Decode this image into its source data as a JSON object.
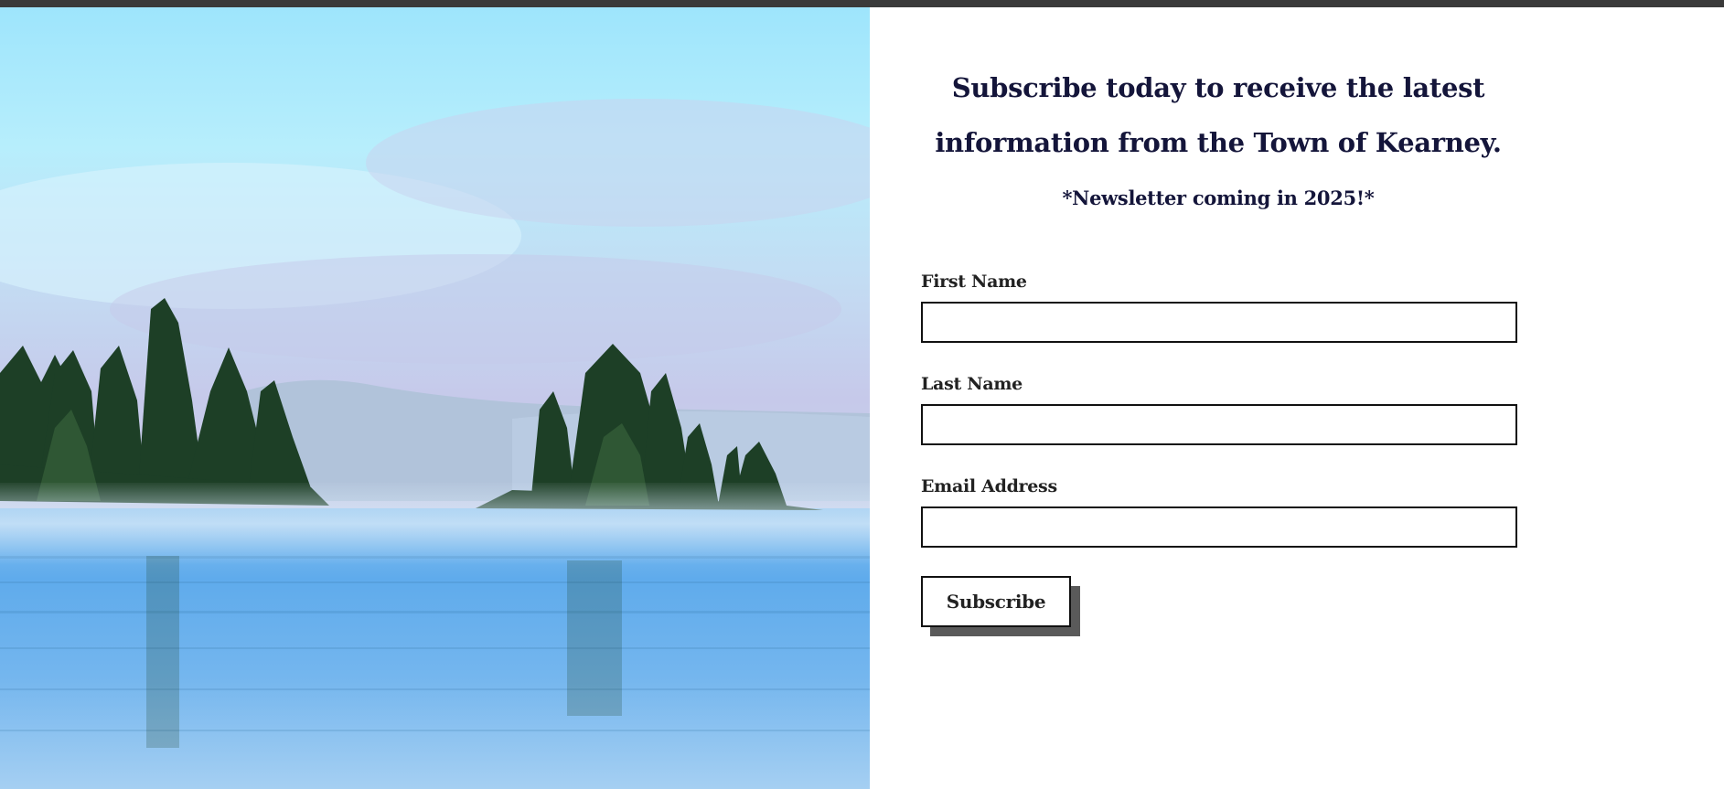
{
  "hero": {
    "image_name": "misty-lake-with-pine-islands",
    "colors": {
      "sky_top": "#9ee4fb",
      "sky_haze": "#c9c8e8",
      "water": "#6cb2ee",
      "trees": "#1d3f26"
    }
  },
  "newsletter": {
    "headline_line1": "Subscribe today to receive the latest",
    "headline_line2": "information from the Town of Kearney.",
    "subline": "*Newsletter coming in 2025!*"
  },
  "form": {
    "first_name": {
      "label": "First Name",
      "value": ""
    },
    "last_name": {
      "label": "Last Name",
      "value": ""
    },
    "email": {
      "label": "Email Address",
      "value": ""
    },
    "submit_label": "Subscribe"
  },
  "colors": {
    "heading": "#14153a",
    "label": "#222222",
    "border": "#111111",
    "button_shadow": "#5a5a5a",
    "top_strip": "#3a3a3a"
  }
}
